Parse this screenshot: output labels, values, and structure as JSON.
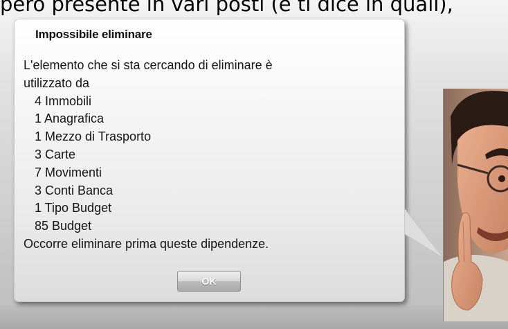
{
  "background": {
    "caption": "però presente in vari posti (e ti dice in quali),"
  },
  "dialog": {
    "title": "Impossibile eliminare",
    "intro_line1": "L'elemento che si sta cercando di eliminare è",
    "intro_line2": "utilizzato da",
    "dependencies": [
      "4 Immobili",
      "1 Anagrafica",
      "1 Mezzo di Trasporto",
      "3 Carte",
      "7 Movimenti",
      "3 Conti Banca",
      "1 Tipo Budget",
      "85 Budget"
    ],
    "footer": "Occorre eliminare prima queste dipendenze.",
    "ok_label": "OK"
  },
  "colors": {
    "dialog_background": "#f5f5f5",
    "button_gray": "#bdbdbd",
    "page_background": "#d0d0d0"
  },
  "icons": [
    "speech-bubble-tail",
    "man-pointing-photo"
  ]
}
